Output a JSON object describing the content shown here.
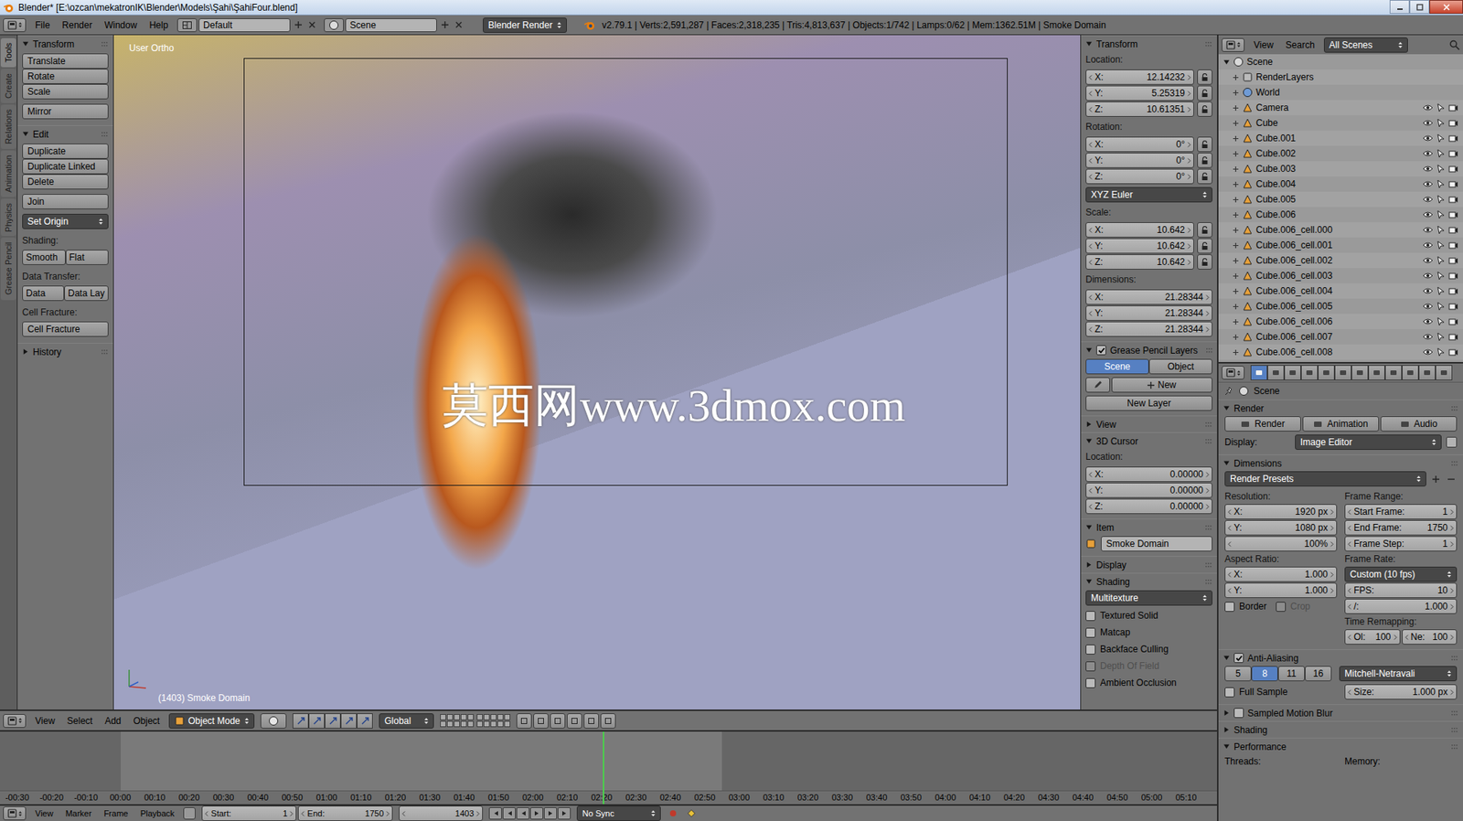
{
  "window": {
    "title": "Blender* [E:\\ozcan\\mekatronIK\\Blender\\Models\\Şahi\\ŞahiFour.blend]"
  },
  "info_header": {
    "menus": [
      "File",
      "Render",
      "Window",
      "Help"
    ],
    "layout": "Default",
    "scene": "Scene",
    "engine": "Blender Render",
    "stats": "v2.79.1 | Verts:2,591,287 | Faces:2,318,235 | Tris:4,813,637 | Objects:1/742 | Lamps:0/62 | Mem:1362.51M | Smoke Domain"
  },
  "tool_tabs": [
    {
      "label": "Tools",
      "selected": true
    },
    {
      "label": "Create",
      "selected": false
    },
    {
      "label": "Relations",
      "selected": false
    },
    {
      "label": "Animation",
      "selected": false
    },
    {
      "label": "Physics",
      "selected": false
    },
    {
      "label": "Grease Pencil",
      "selected": false
    }
  ],
  "tool_shelf": [
    {
      "title": "Transform",
      "expanded": true,
      "items": [
        {
          "kind": "stack",
          "labels": [
            "Translate",
            "Rotate",
            "Scale"
          ]
        },
        {
          "kind": "stack",
          "labels": [
            "Mirror"
          ]
        }
      ]
    },
    {
      "title": "Edit",
      "expanded": true,
      "items": [
        {
          "kind": "stack",
          "labels": [
            "Duplicate",
            "Duplicate Linked",
            "Delete"
          ]
        },
        {
          "kind": "stack",
          "labels": [
            "Join"
          ]
        },
        {
          "kind": "menu",
          "labels": [
            "Set Origin"
          ]
        },
        {
          "kind": "label",
          "labels": [
            "Shading:"
          ]
        },
        {
          "kind": "row",
          "labels": [
            "Smooth",
            "Flat"
          ]
        },
        {
          "kind": "label",
          "labels": [
            "Data Transfer:"
          ]
        },
        {
          "kind": "row",
          "labels": [
            "Data",
            "Data Lay"
          ]
        },
        {
          "kind": "label",
          "labels": [
            "Cell Fracture:"
          ]
        },
        {
          "kind": "stack",
          "labels": [
            "Cell Fracture"
          ]
        }
      ]
    },
    {
      "title": "History",
      "expanded": false,
      "items": []
    }
  ],
  "viewport": {
    "view_name": "User Ortho",
    "object_label": "(1403) Smoke Domain",
    "watermark": "莫西网www.3dmox.com"
  },
  "n_panel": [
    {
      "title": "Transform",
      "expanded": true,
      "items": [
        {
          "kind": "label",
          "text": "Location:"
        },
        {
          "kind": "fields-lock",
          "rows": [
            {
              "label": "X:",
              "value": "12.14232"
            },
            {
              "label": "Y:",
              "value": "5.25319"
            },
            {
              "label": "Z:",
              "value": "10.61351"
            }
          ]
        },
        {
          "kind": "label",
          "text": "Rotation:"
        },
        {
          "kind": "fields-lock",
          "rows": [
            {
              "label": "X:",
              "value": "0°"
            },
            {
              "label": "Y:",
              "value": "0°"
            },
            {
              "label": "Z:",
              "value": "0°"
            }
          ]
        },
        {
          "kind": "menu",
          "text": "XYZ Euler"
        },
        {
          "kind": "label",
          "text": "Scale:"
        },
        {
          "kind": "fields-lock",
          "rows": [
            {
              "label": "X:",
              "value": "10.642"
            },
            {
              "label": "Y:",
              "value": "10.642"
            },
            {
              "label": "Z:",
              "value": "10.642"
            }
          ]
        },
        {
          "kind": "label",
          "text": "Dimensions:"
        },
        {
          "kind": "fields",
          "rows": [
            {
              "label": "X:",
              "value": "21.28344"
            },
            {
              "label": "Y:",
              "value": "21.28344"
            },
            {
              "label": "Z:",
              "value": "21.28344"
            }
          ]
        }
      ]
    },
    {
      "title": "Grease Pencil Layers",
      "expanded": true,
      "checkbox": true,
      "checked": true,
      "items": [
        {
          "kind": "tabs",
          "options": [
            {
              "label": "Scene",
              "selected": true
            },
            {
              "label": "Object",
              "selected": false
            }
          ]
        },
        {
          "kind": "new",
          "text": "New"
        },
        {
          "kind": "button",
          "text": "New Layer"
        }
      ]
    },
    {
      "title": "View",
      "expanded": false,
      "items": []
    },
    {
      "title": "3D Cursor",
      "expanded": true,
      "items": [
        {
          "kind": "label",
          "text": "Location:"
        },
        {
          "kind": "fields",
          "rows": [
            {
              "label": "X:",
              "value": "0.00000"
            },
            {
              "label": "Y:",
              "value": "0.00000"
            },
            {
              "label": "Z:",
              "value": "0.00000"
            }
          ]
        }
      ]
    },
    {
      "title": "Item",
      "expanded": true,
      "items": [
        {
          "kind": "object",
          "text": "Smoke Domain"
        }
      ]
    },
    {
      "title": "Display",
      "expanded": false,
      "items": []
    },
    {
      "title": "Shading",
      "expanded": true,
      "items": [
        {
          "kind": "menu",
          "text": "Multitexture"
        },
        {
          "kind": "checkbox",
          "text": "Textured Solid",
          "checked": false,
          "disabled": false
        },
        {
          "kind": "checkbox",
          "text": "Matcap",
          "checked": false,
          "disabled": false
        },
        {
          "kind": "checkbox",
          "text": "Backface Culling",
          "checked": false,
          "disabled": false
        },
        {
          "kind": "checkbox",
          "text": "Depth Of Field",
          "checked": false,
          "disabled": true
        },
        {
          "kind": "checkbox",
          "text": "Ambient Occlusion",
          "checked": false,
          "disabled": false
        }
      ]
    }
  ],
  "view_header": {
    "menus": [
      "View",
      "Select",
      "Add",
      "Object"
    ],
    "mode": "Object Mode",
    "orientation": "Global"
  },
  "timeline": {
    "ruler": [
      "-00:30",
      "-00:20",
      "-00:10",
      "00:00",
      "00:10",
      "00:20",
      "00:30",
      "00:40",
      "00:50",
      "01:00",
      "01:10",
      "01:20",
      "01:30",
      "01:40",
      "01:50",
      "02:00",
      "02:10",
      "02:20",
      "02:30",
      "02:40",
      "02:50",
      "03:00",
      "03:10",
      "03:20",
      "03:30",
      "03:40",
      "03:50",
      "04:00",
      "04:10",
      "04:20",
      "04:30",
      "04:40",
      "04:50",
      "05:00",
      "05:10"
    ]
  },
  "timeline_header": {
    "menus": [
      "View",
      "Marker",
      "Frame",
      "Playback"
    ],
    "start_label": "Start:",
    "start": "1",
    "end_label": "End:",
    "end": "1750",
    "current": "1403",
    "sync": "No Sync"
  },
  "outliner": {
    "menus": [
      "View",
      "Search"
    ],
    "filter": "All Scenes",
    "items": [
      {
        "name": "Scene",
        "kind": "scene",
        "expanded": true
      },
      {
        "name": "RenderLayers",
        "kind": "renderlayers",
        "expanded": false
      },
      {
        "name": "World",
        "kind": "world",
        "expanded": false
      },
      {
        "name": "Camera",
        "kind": "camera",
        "expanded": false
      },
      {
        "name": "Cube",
        "kind": "mesh",
        "expanded": false
      },
      {
        "name": "Cube.001",
        "kind": "mesh",
        "expanded": false
      },
      {
        "name": "Cube.002",
        "kind": "mesh",
        "expanded": false
      },
      {
        "name": "Cube.003",
        "kind": "mesh",
        "expanded": false
      },
      {
        "name": "Cube.004",
        "kind": "mesh",
        "expanded": false
      },
      {
        "name": "Cube.005",
        "kind": "mesh",
        "expanded": false
      },
      {
        "name": "Cube.006",
        "kind": "mesh",
        "expanded": false
      },
      {
        "name": "Cube.006_cell.000",
        "kind": "mesh",
        "expanded": false
      },
      {
        "name": "Cube.006_cell.001",
        "kind": "mesh",
        "expanded": false
      },
      {
        "name": "Cube.006_cell.002",
        "kind": "mesh",
        "expanded": false
      },
      {
        "name": "Cube.006_cell.003",
        "kind": "mesh",
        "expanded": false
      },
      {
        "name": "Cube.006_cell.004",
        "kind": "mesh",
        "expanded": false
      },
      {
        "name": "Cube.006_cell.005",
        "kind": "mesh",
        "expanded": false
      },
      {
        "name": "Cube.006_cell.006",
        "kind": "mesh",
        "expanded": false
      },
      {
        "name": "Cube.006_cell.007",
        "kind": "mesh",
        "expanded": false
      },
      {
        "name": "Cube.006_cell.008",
        "kind": "mesh",
        "expanded": false
      }
    ]
  },
  "properties": {
    "tabs": [
      {
        "selected": true
      },
      {
        "selected": false
      },
      {
        "selected": false
      },
      {
        "selected": false
      },
      {
        "selected": false
      },
      {
        "selected": false
      },
      {
        "selected": false
      },
      {
        "selected": false
      },
      {
        "selected": false
      },
      {
        "selected": false
      },
      {
        "selected": false
      },
      {
        "selected": false
      }
    ],
    "context": "Scene",
    "render": {
      "title": "Render",
      "expanded": true,
      "buttons": [
        "Render",
        "Animation",
        "Audio"
      ],
      "display_label": "Display:",
      "display": "Image Editor"
    },
    "dimensions": {
      "title": "Dimensions",
      "expanded": true,
      "presets": "Render Presets",
      "left": [
        {
          "kind": "label",
          "text": "Resolution:"
        },
        {
          "kind": "field",
          "label": "X:",
          "value": "1920 px"
        },
        {
          "kind": "field",
          "label": "Y:",
          "value": "1080 px"
        },
        {
          "kind": "field",
          "label": "",
          "value": "100%"
        },
        {
          "kind": "label",
          "text": "Aspect Ratio:"
        },
        {
          "kind": "field",
          "label": "X:",
          "value": "1.000"
        },
        {
          "kind": "field",
          "label": "Y:",
          "value": "1.000"
        },
        {
          "kind": "checks",
          "options": [
            {
              "label": "Border",
              "checked": false,
              "disabled": false
            },
            {
              "label": "Crop",
              "checked": false,
              "disabled": true
            }
          ]
        }
      ],
      "right": [
        {
          "kind": "label",
          "text": "Frame Range:"
        },
        {
          "kind": "field",
          "label": "Start Frame:",
          "value": "1"
        },
        {
          "kind": "field",
          "label": "End Frame:",
          "value": "1750"
        },
        {
          "kind": "field",
          "label": "Frame Step:",
          "value": "1"
        },
        {
          "kind": "label",
          "text": "Frame Rate:"
        },
        {
          "kind": "menu",
          "text": "Custom (10 fps)"
        },
        {
          "kind": "field",
          "label": "FPS:",
          "value": "10"
        },
        {
          "kind": "field",
          "label": "/:",
          "value": "1.000"
        },
        {
          "kind": "label",
          "text": "Time Remapping:"
        },
        {
          "kind": "pair",
          "fields": [
            {
              "label": "Ol:",
              "value": "100"
            },
            {
              "label": "Ne:",
              "value": "100"
            }
          ]
        }
      ]
    },
    "anti_aliasing": {
      "title": "Anti-Aliasing",
      "expanded": true,
      "checked": true,
      "samples": [
        {
          "label": "5",
          "selected": false
        },
        {
          "label": "8",
          "selected": true
        },
        {
          "label": "11",
          "selected": false
        },
        {
          "label": "16",
          "selected": false
        }
      ],
      "filter": "Mitchell-Netravali",
      "full_sample": {
        "label": "Full Sample",
        "checked": false
      },
      "size_label": "Size:",
      "size": "1.000 px"
    },
    "collapsed": [
      {
        "title": "Sampled Motion Blur",
        "expanded": false,
        "checkbox": true,
        "checked": false
      },
      {
        "title": "Shading",
        "expanded": false
      }
    ],
    "performance": {
      "title": "Performance",
      "expanded": true,
      "labels": [
        "Threads:",
        "Memory:"
      ]
    }
  }
}
